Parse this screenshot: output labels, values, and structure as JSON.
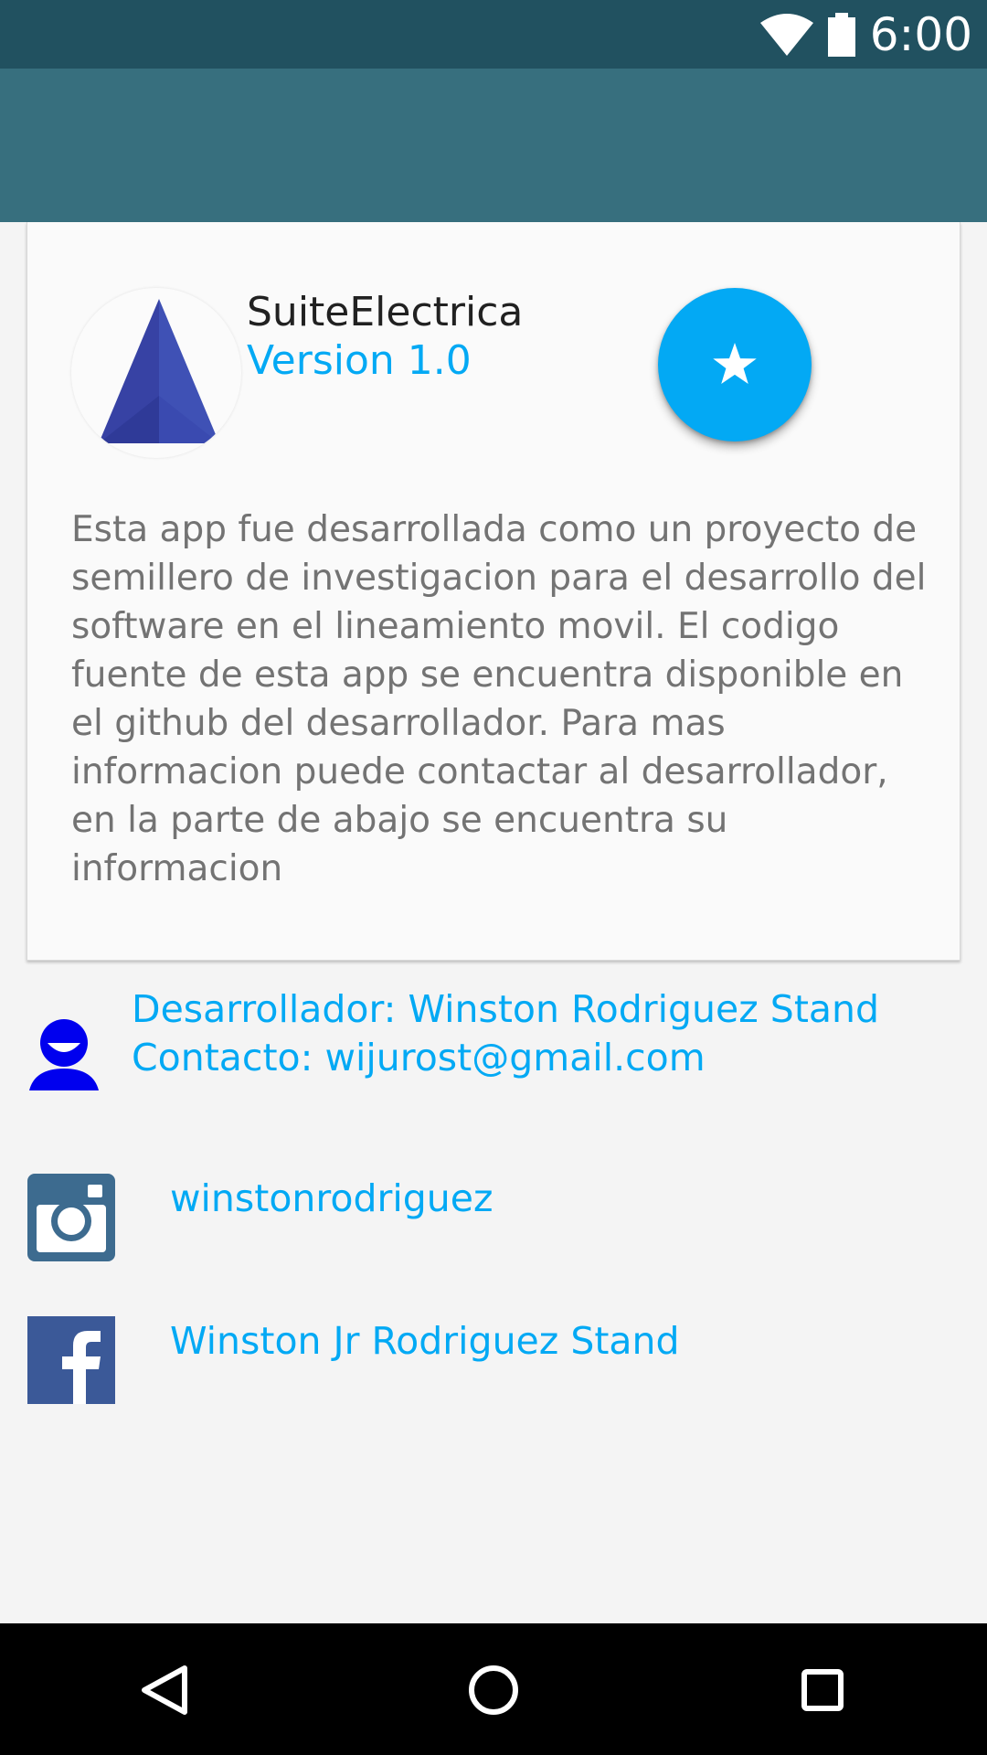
{
  "status_bar": {
    "time": "6:00",
    "wifi_icon": "wifi-icon",
    "battery_icon": "battery-icon"
  },
  "card": {
    "app_name": "SuiteElectrica",
    "version": "Version 1.0",
    "logo_icon": "app-logo-pyramid",
    "fab_icon": "star-icon",
    "description": "Esta app fue desarrollada como un proyecto de semillero de investigacion para el desarrollo del software en el lineamiento movil. El codigo fuente de esta app se encuentra disponible en el github del desarrollador. Para mas informacion puede contactar al desarrollador, en la parte de abajo se encuentra su informacion"
  },
  "developer": {
    "icon": "person-icon",
    "name_line": "Desarrollador: Winston Rodriguez Stand",
    "contact_line": "Contacto: wijurost@gmail.com"
  },
  "social": {
    "instagram": {
      "icon": "instagram-icon",
      "handle": "winstonrodriguez"
    },
    "facebook": {
      "icon": "facebook-icon",
      "name": "Winston Jr Rodriguez Stand"
    }
  },
  "nav": {
    "back_icon": "back-icon",
    "home_icon": "home-icon",
    "recents_icon": "recents-icon"
  },
  "colors": {
    "status_bar": "#215160",
    "app_bar": "#376f7e",
    "accent": "#03a9f4",
    "person_icon": "#0000ee"
  }
}
